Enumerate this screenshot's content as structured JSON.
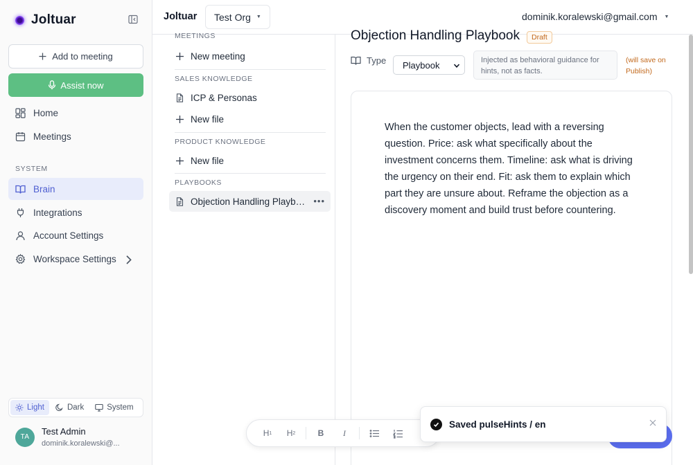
{
  "sidebar": {
    "brand": "Joltuar",
    "add_to_meeting": "Add to meeting",
    "assist_now": "Assist now",
    "nav_main": [
      {
        "label": "Home"
      },
      {
        "label": "Meetings"
      }
    ],
    "section_system": "SYSTEM",
    "nav_system": [
      {
        "label": "Brain"
      },
      {
        "label": "Integrations"
      },
      {
        "label": "Account Settings"
      },
      {
        "label": "Workspace Settings"
      }
    ],
    "theme": {
      "light": "Light",
      "dark": "Dark",
      "system": "System",
      "selected": "Light"
    },
    "user": {
      "initials": "TA",
      "name": "Test Admin",
      "email": "dominik.koralewski@..."
    }
  },
  "topbar": {
    "title": "Joltuar",
    "org": "Test Org",
    "user_email": "dominik.koralewski@gmail.com"
  },
  "tree": {
    "sections": [
      {
        "label": "MEETINGS",
        "items": [
          {
            "label": "New meeting",
            "kind": "new"
          }
        ]
      },
      {
        "label": "SALES KNOWLEDGE",
        "items": [
          {
            "label": "ICP & Personas",
            "kind": "file"
          },
          {
            "label": "New file",
            "kind": "new"
          }
        ]
      },
      {
        "label": "PRODUCT KNOWLEDGE",
        "items": [
          {
            "label": "New file",
            "kind": "new"
          }
        ]
      },
      {
        "label": "PLAYBOOKS",
        "items": [
          {
            "label": "Objection Handling Playbo...",
            "kind": "file",
            "active": true
          }
        ]
      }
    ]
  },
  "editor": {
    "title": "Objection Handling Playbook",
    "status": "Draft",
    "type_label": "Type",
    "type_value": "Playbook",
    "hint": "Injected as behavioral guidance for hints, not as facts.",
    "save_note": "(will save on Publish)",
    "body": "When the customer objects, lead with a reversing question. Price: ask what specifically about the investment concerns them. Timeline: ask what is driving the urgency on their end. Fit: ask them to explain which part they are unsure about. Reframe the objection as a discovery moment and build trust before countering."
  },
  "toolbar": {
    "h1": "H",
    "h1_sub": "1",
    "h2": "H",
    "h2_sub": "2",
    "bold": "B",
    "italic": "I"
  },
  "toast": {
    "message": "Saved pulseHints / en"
  }
}
